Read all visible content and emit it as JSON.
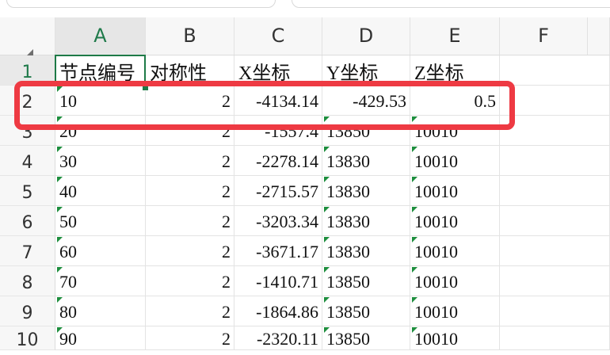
{
  "columns": [
    "A",
    "B",
    "C",
    "D",
    "E",
    "F"
  ],
  "row_numbers": [
    "1",
    "2",
    "3",
    "4",
    "5",
    "6",
    "7",
    "8",
    "9",
    "10"
  ],
  "header_row": [
    "节点编号",
    "对称性",
    "X坐标",
    "Y坐标",
    "Z坐标"
  ],
  "rows": [
    [
      "10",
      "2",
      "-4134.14",
      "-429.53",
      "0.5"
    ],
    [
      "20",
      "2",
      "-1557.4",
      "13850",
      "10010"
    ],
    [
      "30",
      "2",
      "-2278.14",
      "13830",
      "10010"
    ],
    [
      "40",
      "2",
      "-2715.57",
      "13830",
      "10010"
    ],
    [
      "50",
      "2",
      "-3203.34",
      "13830",
      "10010"
    ],
    [
      "60",
      "2",
      "-3671.17",
      "13830",
      "10010"
    ],
    [
      "70",
      "2",
      "-1410.71",
      "13850",
      "10010"
    ],
    [
      "80",
      "2",
      "-1864.86",
      "13850",
      "10010"
    ],
    [
      "90",
      "2",
      "-2320.11",
      "13850",
      "10010"
    ]
  ],
  "selected_cell": "A1",
  "colors": {
    "highlight": "#ee3a43",
    "selection": "#1e7a47",
    "number_as_text_marker": "#1e8e3e"
  }
}
